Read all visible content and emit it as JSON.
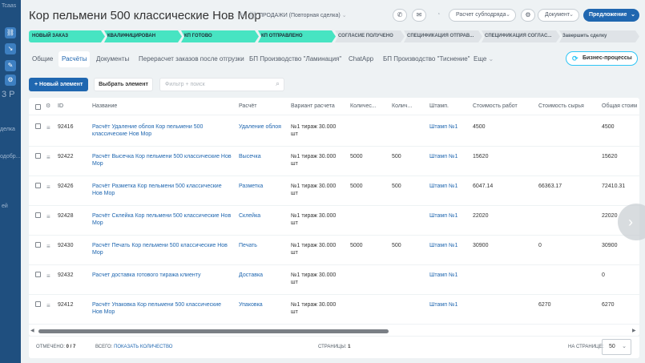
{
  "background": {
    "left_icons": [
      "link-icon",
      "arrow-icon",
      "edit-icon",
      "settings-icon"
    ],
    "fragments": [
      "Tcaas",
      "3 P",
      "делка",
      "одобр...",
      "ей"
    ]
  },
  "header": {
    "title": "Кор пельмени 500 классические Нов Мор",
    "deal_type": "ПРОДАЖИ (Повторная сделка)",
    "template_select": "Расчет субподряда",
    "document_select": "Документ",
    "primary_button": "Предложение"
  },
  "stages": [
    {
      "label": "НОВЫЙ ЗАКАЗ",
      "done": true
    },
    {
      "label": "КВАЛИФИЦИРОВАН",
      "done": true
    },
    {
      "label": "КП ГОТОВО",
      "done": true
    },
    {
      "label": "КП ОТПРАВЛЕНО",
      "done": true
    },
    {
      "label": "СОГЛАСИЕ ПОЛУЧЕНО",
      "done": false
    },
    {
      "label": "СПЕЦИФИКАЦИЯ ОТПРАВ...",
      "done": false
    },
    {
      "label": "СПЕЦИФИКАЦИЯ СОГЛАС...",
      "done": false
    },
    {
      "label": "Завершить сделку",
      "done": false
    }
  ],
  "tabs": [
    {
      "label": "Общие"
    },
    {
      "label": "Расчёты",
      "active": true
    },
    {
      "label": "Документы"
    },
    {
      "label": "Перерасчет заказов после отгрузки"
    },
    {
      "label": "БП Производство \"Ламинация\""
    },
    {
      "label": "ChatApp"
    },
    {
      "label": "БП Производство \"Тиснение\""
    },
    {
      "label": "Еще"
    }
  ],
  "bp_button": "Бизнес-процессы",
  "toolbar": {
    "add_label": "+ Новый элемент",
    "choose_label": "Выбрать элемент",
    "filter_placeholder": "Фильтр + поиск"
  },
  "grid": {
    "columns": [
      "ID",
      "Название",
      "Расчёт",
      "Вариант расчета",
      "Количес...",
      "Колич...",
      "Штамп.",
      "Стоимость работ",
      "Стоимость сырья",
      "Общая стоим"
    ],
    "rows": [
      {
        "id": "92416",
        "name": "Расчёт Удаление облоя Кор пельмени 500 классические Нов Мор",
        "calc": "Удаление облоя",
        "variant": "№1 тираж 30.000 шт",
        "qty1": "",
        "qty2": "",
        "stamp": "Штамп №1",
        "work": "4500",
        "raw": "",
        "total": "4500"
      },
      {
        "id": "92422",
        "name": "Расчёт Высечка Кор пельмени 500 классические Нов Мор",
        "calc": "Высечка",
        "variant": "№1 тираж 30.000 шт",
        "qty1": "5000",
        "qty2": "500",
        "stamp": "Штамп №1",
        "work": "15620",
        "raw": "",
        "total": "15620"
      },
      {
        "id": "92426",
        "name": "Расчёт Разметка Кор пельмени 500 классические Нов Мор",
        "calc": "Разметка",
        "variant": "№1 тираж 30.000 шт",
        "qty1": "5000",
        "qty2": "500",
        "stamp": "Штамп №1",
        "work": "6047.14",
        "raw": "66363.17",
        "total": "72410.31"
      },
      {
        "id": "92428",
        "name": "Расчёт Склейка Кор пельмени 500 классические Нов Мор",
        "calc": "Склейка",
        "variant": "№1 тираж 30.000 шт",
        "qty1": "",
        "qty2": "",
        "stamp": "Штамп №1",
        "work": "22020",
        "raw": "",
        "total": "22020"
      },
      {
        "id": "92430",
        "name": "Расчёт Печать Кор пельмени 500 классические Нов Мор",
        "calc": "Печать",
        "variant": "№1 тираж 30.000 шт",
        "qty1": "5000",
        "qty2": "500",
        "stamp": "Штамп №1",
        "work": "30900",
        "raw": "0",
        "total": "30900"
      },
      {
        "id": "92432",
        "name": "Расчет доставка готового тиража клиенту",
        "calc": "Доставка",
        "variant": "№1 тираж 30.000 шт",
        "qty1": "",
        "qty2": "",
        "stamp": "Штамп №1",
        "work": "",
        "raw": "",
        "total": "0"
      },
      {
        "id": "92412",
        "name": "Расчёт Упаковка Кор пельмени 500 классические Нов Мор",
        "calc": "Упаковка",
        "variant": "№1 тираж 30.000 шт",
        "qty1": "",
        "qty2": "",
        "stamp": "Штамп №1",
        "work": "",
        "raw": "6270",
        "total": "6270"
      }
    ]
  },
  "footer": {
    "checked_label": "ОТМЕЧЕНО:",
    "checked_value": "0 / 7",
    "total_label": "ВСЕГО:",
    "total_link": "ПОКАЗАТЬ КОЛИЧЕСТВО",
    "pages_label": "СТРАНИЦЫ:",
    "pages_value": "1",
    "per_page_label": "НА СТРАНИЦЕ:",
    "per_page_value": "50"
  },
  "colors": {
    "accent": "#2067b0",
    "stage_done": "#47e4c2",
    "stage_todo": "#dfe3e7",
    "bp_border": "#2fc6f6"
  }
}
